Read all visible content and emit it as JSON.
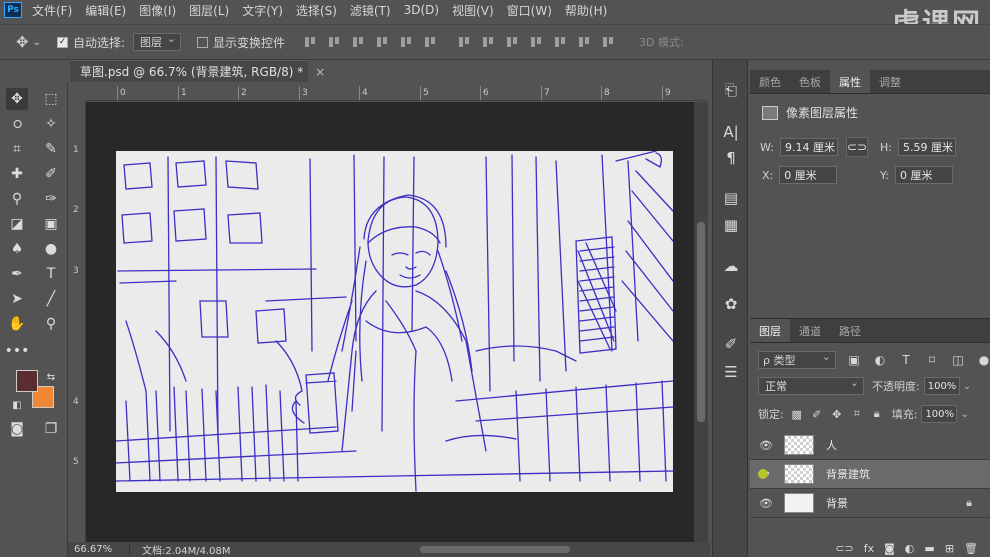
{
  "menubar": {
    "logo": "Ps",
    "items": [
      "文件(F)",
      "编辑(E)",
      "图像(I)",
      "图层(L)",
      "文字(Y)",
      "选择(S)",
      "滤镜(T)",
      "3D(D)",
      "视图(V)",
      "窗口(W)",
      "帮助(H)"
    ]
  },
  "options": {
    "move_icon": "move-icon",
    "auto_select_label": "自动选择:",
    "auto_select_value": "图层",
    "show_transform_label": "显示变换控件",
    "mode3d": "3D 模式:",
    "watermark": "虎课网"
  },
  "document": {
    "tab_title": "草图.psd @ 66.7% (背景建筑, RGB/8) *",
    "close": "×",
    "ruler_h": [
      "0",
      "1",
      "2",
      "3",
      "4",
      "5",
      "6",
      "7",
      "8",
      "9"
    ],
    "ruler_v": [
      "1",
      "2",
      "3",
      "4",
      "5"
    ],
    "sketch_color": "#3b2fc4"
  },
  "status": {
    "zoom": "66.67%",
    "doc_info": "文档:2.04M/4.08M"
  },
  "colors": {
    "foreground": "#5b2c30",
    "background": "#ef8734"
  },
  "properties_panel": {
    "tabs": [
      "颜色",
      "色板",
      "属性",
      "调整"
    ],
    "active_tab": "属性",
    "title": "像素图层属性",
    "w_label": "W:",
    "w_value": "9.14 厘米",
    "h_label": "H:",
    "h_value": "5.59 厘米",
    "x_label": "X:",
    "x_value": "0 厘米",
    "y_label": "Y:",
    "y_value": "0 厘米"
  },
  "layers_panel": {
    "tabs": [
      "图层",
      "通道",
      "路径"
    ],
    "filter_label": "ρ 类型",
    "blend_mode": "正常",
    "opacity_label": "不透明度:",
    "opacity_value": "100%",
    "lock_label": "锁定:",
    "fill_label": "填充:",
    "fill_value": "100%",
    "layers": [
      {
        "name": "人",
        "visible": true,
        "thumb": "checker"
      },
      {
        "name": "背景建筑",
        "visible": true,
        "thumb": "checker",
        "selected": true
      },
      {
        "name": "背景",
        "visible": true,
        "thumb": "white",
        "locked": true
      }
    ]
  }
}
